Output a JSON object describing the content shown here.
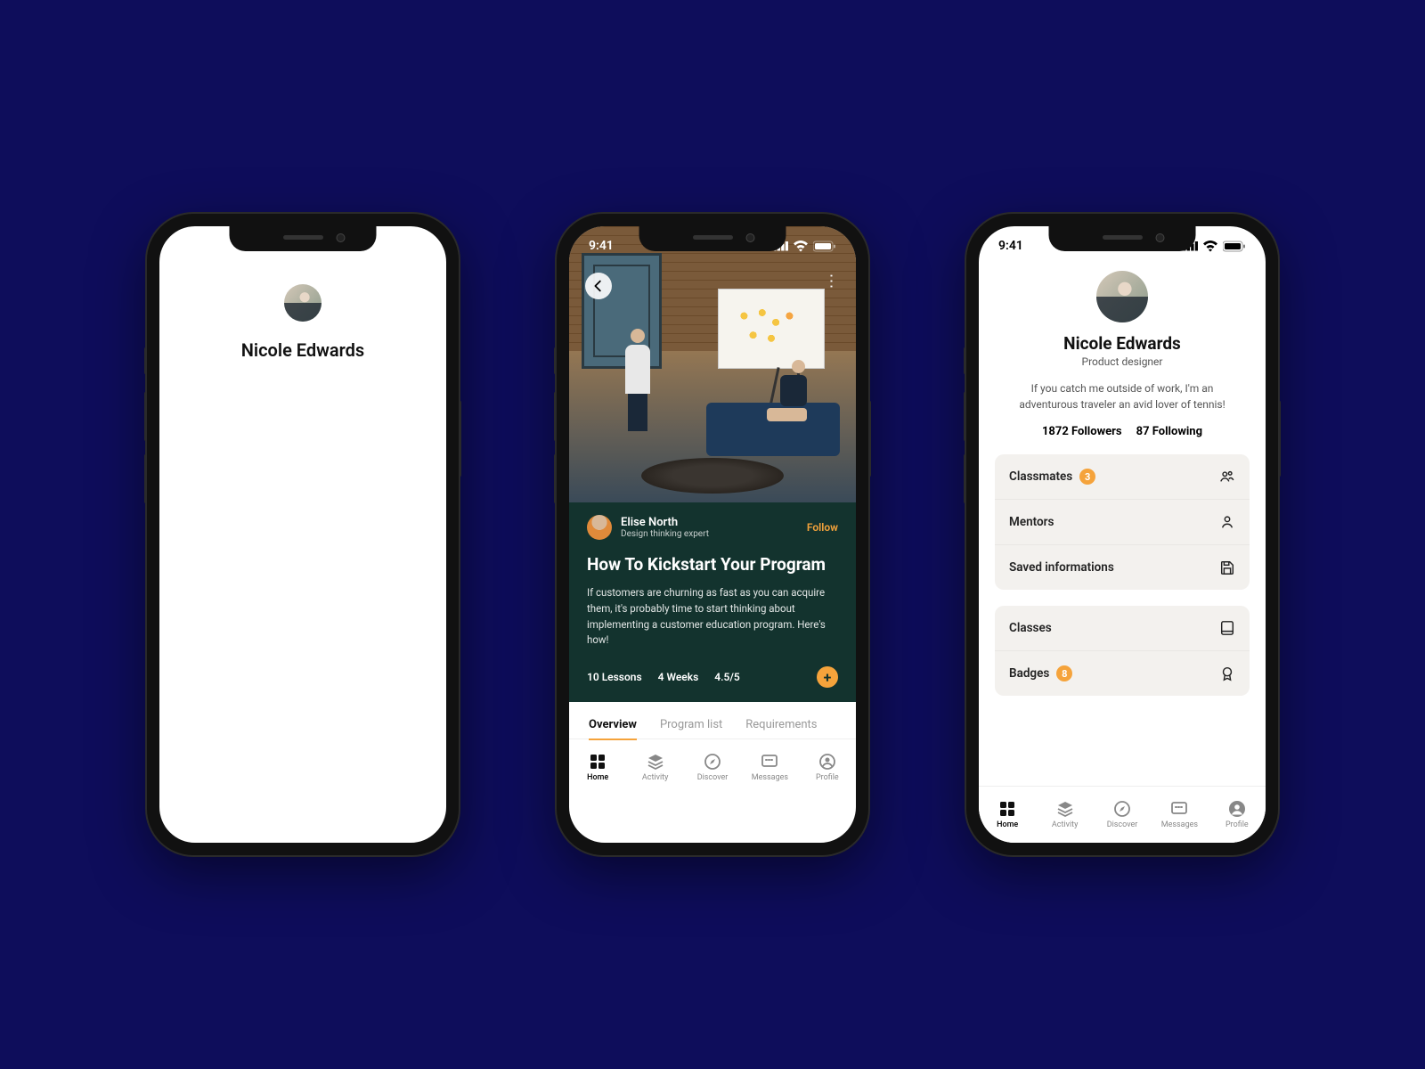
{
  "status_time": "9:41",
  "screen1": {
    "name": "Nicole Edwards"
  },
  "screen2": {
    "author_name": "Elise North",
    "author_role": "Design thinking expert",
    "follow": "Follow",
    "title": "How To Kickstart Your Program",
    "description": "If customers are churning as fast as you can acquire them, it's probably time to start thinking about implementing a customer education program. Here's how!",
    "stat1": "10 Lessons",
    "stat2": "4 Weeks",
    "stat3": "4.5/5",
    "tabs": {
      "t1": "Overview",
      "t2": "Program list",
      "t3": "Requirements"
    }
  },
  "screen3": {
    "name": "Nicole Edwards",
    "role": "Product designer",
    "bio": "If you catch me outside of work, I'm an adventurous traveler an avid lover of tennis!",
    "followers_count": "1872",
    "followers_label": "Followers",
    "following_count": "87",
    "following_label": "Following",
    "items": {
      "classmates": "Classmates",
      "classmates_badge": "3",
      "mentors": "Mentors",
      "saved": "Saved informations",
      "classes": "Classes",
      "badges": "Badges",
      "badges_badge": "8"
    }
  },
  "nav": {
    "home": "Home",
    "activity": "Activity",
    "discover": "Discover",
    "messages": "Messages",
    "profile": "Profile"
  }
}
